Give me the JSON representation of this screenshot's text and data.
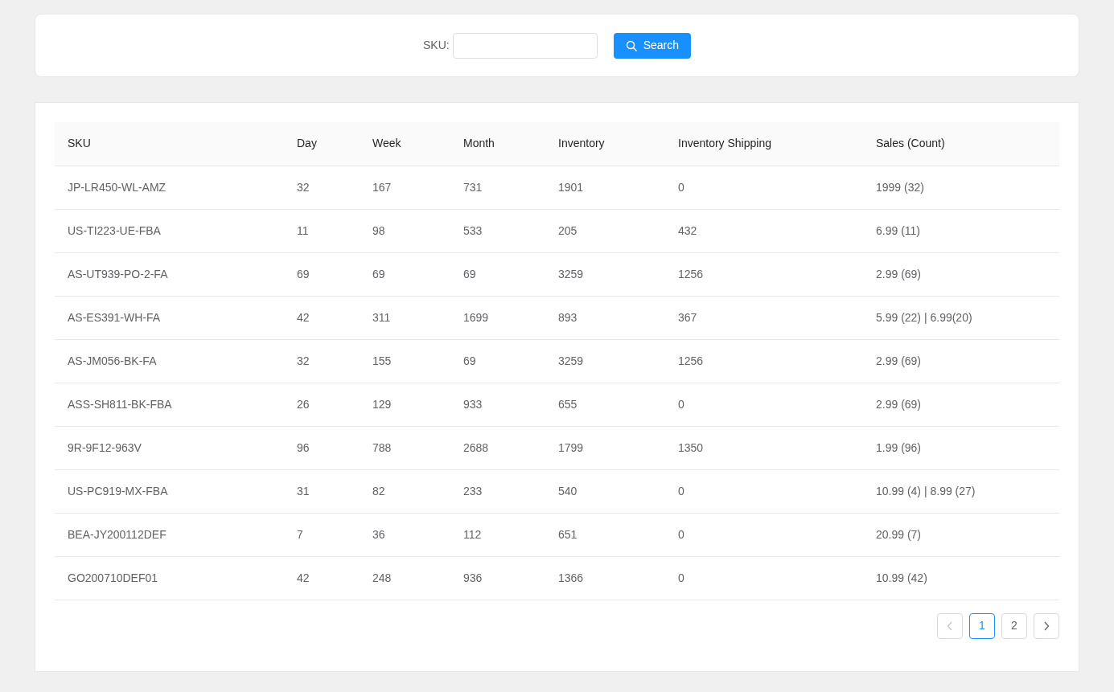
{
  "search": {
    "label": "SKU:",
    "button": "Search"
  },
  "table": {
    "columns": [
      "SKU",
      "Day",
      "Week",
      "Month",
      "Inventory",
      "Inventory Shipping",
      "Sales (Count)"
    ],
    "rows": [
      [
        "JP-LR450-WL-AMZ",
        "32",
        "167",
        "731",
        "1901",
        "0",
        "1999 (32)"
      ],
      [
        "US-TI223-UE-FBA",
        "11",
        "98",
        "533",
        "205",
        "432",
        "6.99 (11)"
      ],
      [
        "AS-UT939-PO-2-FA",
        "69",
        "69",
        "69",
        "3259",
        "1256",
        "2.99 (69)"
      ],
      [
        "AS-ES391-WH-FA",
        "42",
        "311",
        "1699",
        "893",
        "367",
        "5.99 (22) | 6.99(20)"
      ],
      [
        "AS-JM056-BK-FA",
        "32",
        "155",
        "69",
        "3259",
        "1256",
        "2.99 (69)"
      ],
      [
        "ASS-SH811-BK-FBA",
        "26",
        "129",
        "933",
        "655",
        "0",
        "2.99 (69)"
      ],
      [
        "9R-9F12-963V",
        "96",
        "788",
        "2688",
        "1799",
        "1350",
        "1.99 (96)"
      ],
      [
        "US-PC919-MX-FBA",
        "31",
        "82",
        "233",
        "540",
        "0",
        "10.99 (4) | 8.99 (27)"
      ],
      [
        "BEA-JY200112DEF",
        "7",
        "36",
        "112",
        "651",
        "0",
        "20.99 (7)"
      ],
      [
        "GO200710DEF01",
        "42",
        "248",
        "936",
        "1366",
        "0",
        "10.99 (42)"
      ]
    ]
  },
  "pagination": {
    "prev_disabled": true,
    "next_disabled": false,
    "pages": [
      {
        "label": "1",
        "selected": true
      },
      {
        "label": "2",
        "selected": false
      }
    ]
  }
}
